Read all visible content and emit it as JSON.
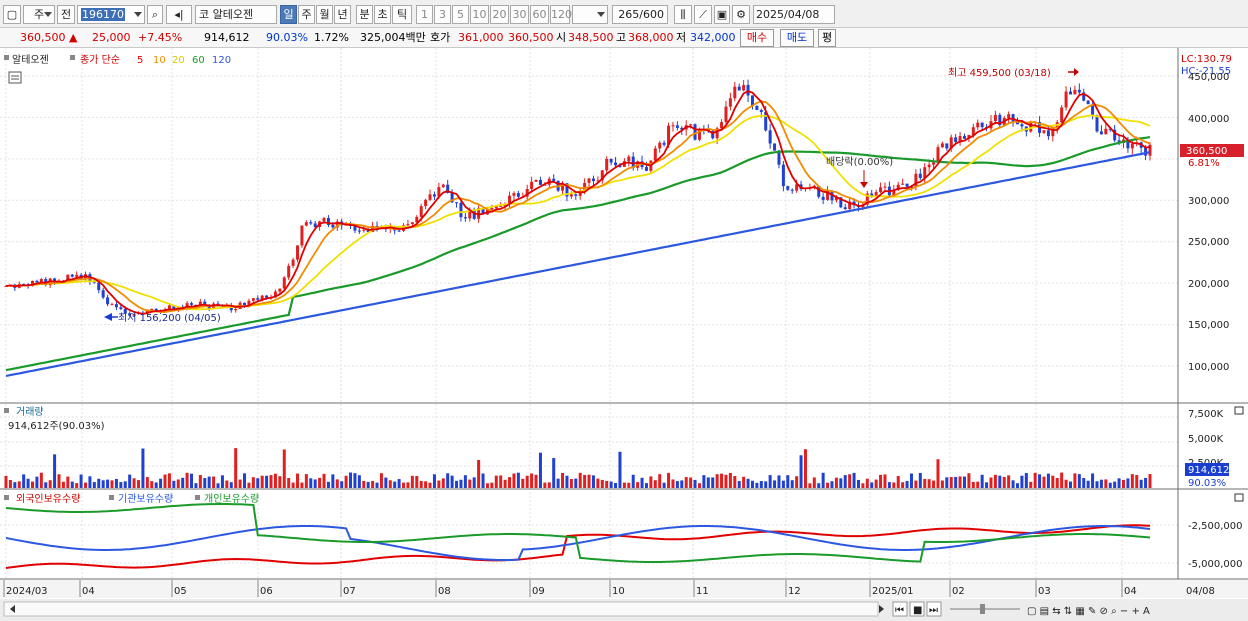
{
  "toolbar": {
    "market_btn": "주",
    "prev_btn": "전",
    "stock_code": "196170",
    "market_tag": "코",
    "stock_name": "알테오젠",
    "periods": [
      "일",
      "주",
      "월",
      "년",
      "분",
      "초",
      "틱"
    ],
    "active_period": "일",
    "intervals": [
      "1",
      "3",
      "5",
      "10",
      "20",
      "30",
      "60",
      "120"
    ],
    "count": "265",
    "count_max": "/600",
    "date": "2025/04/08"
  },
  "quote": {
    "price": "360,500",
    "change": "25,000",
    "change_pct": "+7.45%",
    "volume": "914,612",
    "vol_ratio": "90.03%",
    "turnover": "1.72%",
    "amount": "325,004백만",
    "ask_label": "호가",
    "ask": "361,000",
    "bid": "360,500",
    "open_label": "시",
    "open": "348,500",
    "high_label": "고",
    "high": "368,000",
    "low_label": "저",
    "low": "342,000",
    "buy_btn": "매수",
    "sell_btn": "매도",
    "eval_btn": "평"
  },
  "main_panel": {
    "stock_name": "알테오젠",
    "legend_prefix": "종가 단순",
    "ma_items": [
      {
        "label": "5",
        "color": "#e00000"
      },
      {
        "label": "10",
        "color": "#f08c00"
      },
      {
        "label": "20",
        "color": "#e8d800"
      },
      {
        "label": "60",
        "color": "#1a9a2a"
      },
      {
        "label": "120",
        "color": "#2c58e0"
      }
    ],
    "lc": "LC:130.79",
    "hc": "HC:-21.55",
    "price_ticks": [
      "450,000",
      "400,000",
      "350,000",
      "300,000",
      "250,000",
      "200,000",
      "150,000",
      "100,000"
    ],
    "max_annotation": "최고 459,500 (03/18)",
    "min_annotation": "최저 156,200 (04/05)",
    "dividend_annotation": "배당락(0.00%)",
    "price_tag": "360,500",
    "pct_tag": "6.81%"
  },
  "volume_panel": {
    "title": "거래량",
    "value": "914,612주(90.03%)",
    "ticks": [
      "7,500K",
      "5,000K",
      "2,500K"
    ],
    "vol_tag": "914,612",
    "ratio_tag": "90.03%"
  },
  "holdings_panel": {
    "legend": [
      {
        "label": "외국인보유수량",
        "color": "#e00000"
      },
      {
        "label": "기관보유수량",
        "color": "#2c58e0"
      },
      {
        "label": "개인보유수량",
        "color": "#1a9a2a"
      }
    ],
    "ticks": [
      "-2,500,000",
      "-5,000,000"
    ]
  },
  "x_axis": [
    "2024/03",
    "04",
    "05",
    "06",
    "07",
    "08",
    "09",
    "10",
    "11",
    "12",
    "2025/01",
    "02",
    "03",
    "04",
    "04/08"
  ]
}
